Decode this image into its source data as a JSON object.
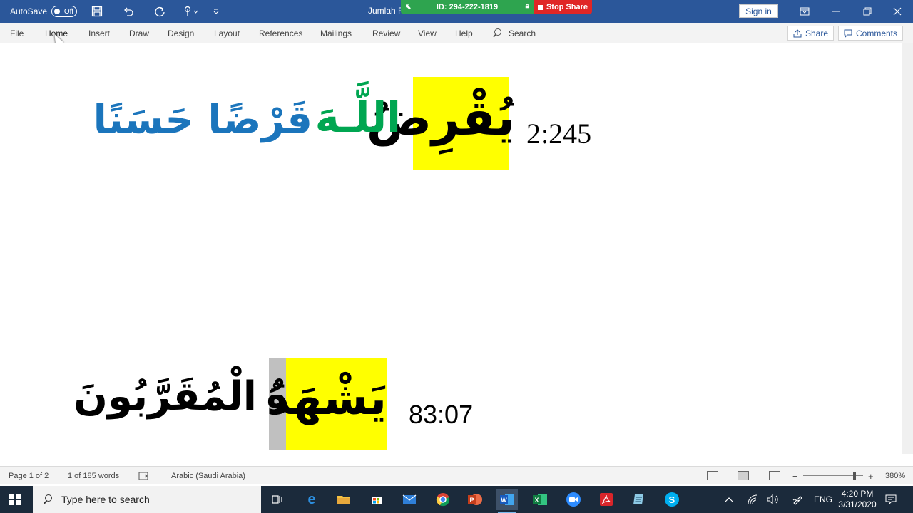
{
  "titlebar": {
    "autosave_label": "AutoSave",
    "autosave_state": "Off",
    "doc_title": "Jumlah F",
    "meeting_id": "ID: 294-222-1819",
    "stop_share": "Stop Share",
    "sign_in": "Sign in",
    "brand_color": "#2b579a"
  },
  "ribbon": {
    "tabs": [
      "File",
      "Home",
      "Insert",
      "Draw",
      "Design",
      "Layout",
      "References",
      "Mailings",
      "Review",
      "View",
      "Help"
    ],
    "active_tab": "Home",
    "search_label": "Search",
    "share_label": "Share",
    "comments_label": "Comments"
  },
  "document": {
    "verse1": {
      "ref": "2:245",
      "highlighted_word": "يُقْرِضُ",
      "green_word": "اللَّـهَ",
      "blue_words": "قَرْضًا حَسَنًا"
    },
    "verse2": {
      "ref": "83:07",
      "highlighted_word": "يَشْهَدُ",
      "grey_part": "هُ",
      "black_word": "الْمُقَرَّبُونَ"
    },
    "colors": {
      "highlight": "#ffff00",
      "grey_highlight": "#c0c0c0",
      "green_text": "#00a651",
      "blue_text": "#1b75bc"
    }
  },
  "statusbar": {
    "page": "Page 1 of 2",
    "words": "1 of 185 words",
    "language": "Arabic (Saudi Arabia)",
    "zoom_minus": "−",
    "zoom_plus": "+",
    "zoom": "380%"
  },
  "taskbar": {
    "search_placeholder": "Type here to search",
    "language": "ENG",
    "time": "4:20 PM",
    "date": "3/31/2020",
    "apps": [
      "task-view",
      "edge",
      "file-explorer",
      "store",
      "mail",
      "chrome",
      "powerpoint",
      "word",
      "excel",
      "zoom",
      "acrobat",
      "notepad",
      "skype"
    ]
  }
}
